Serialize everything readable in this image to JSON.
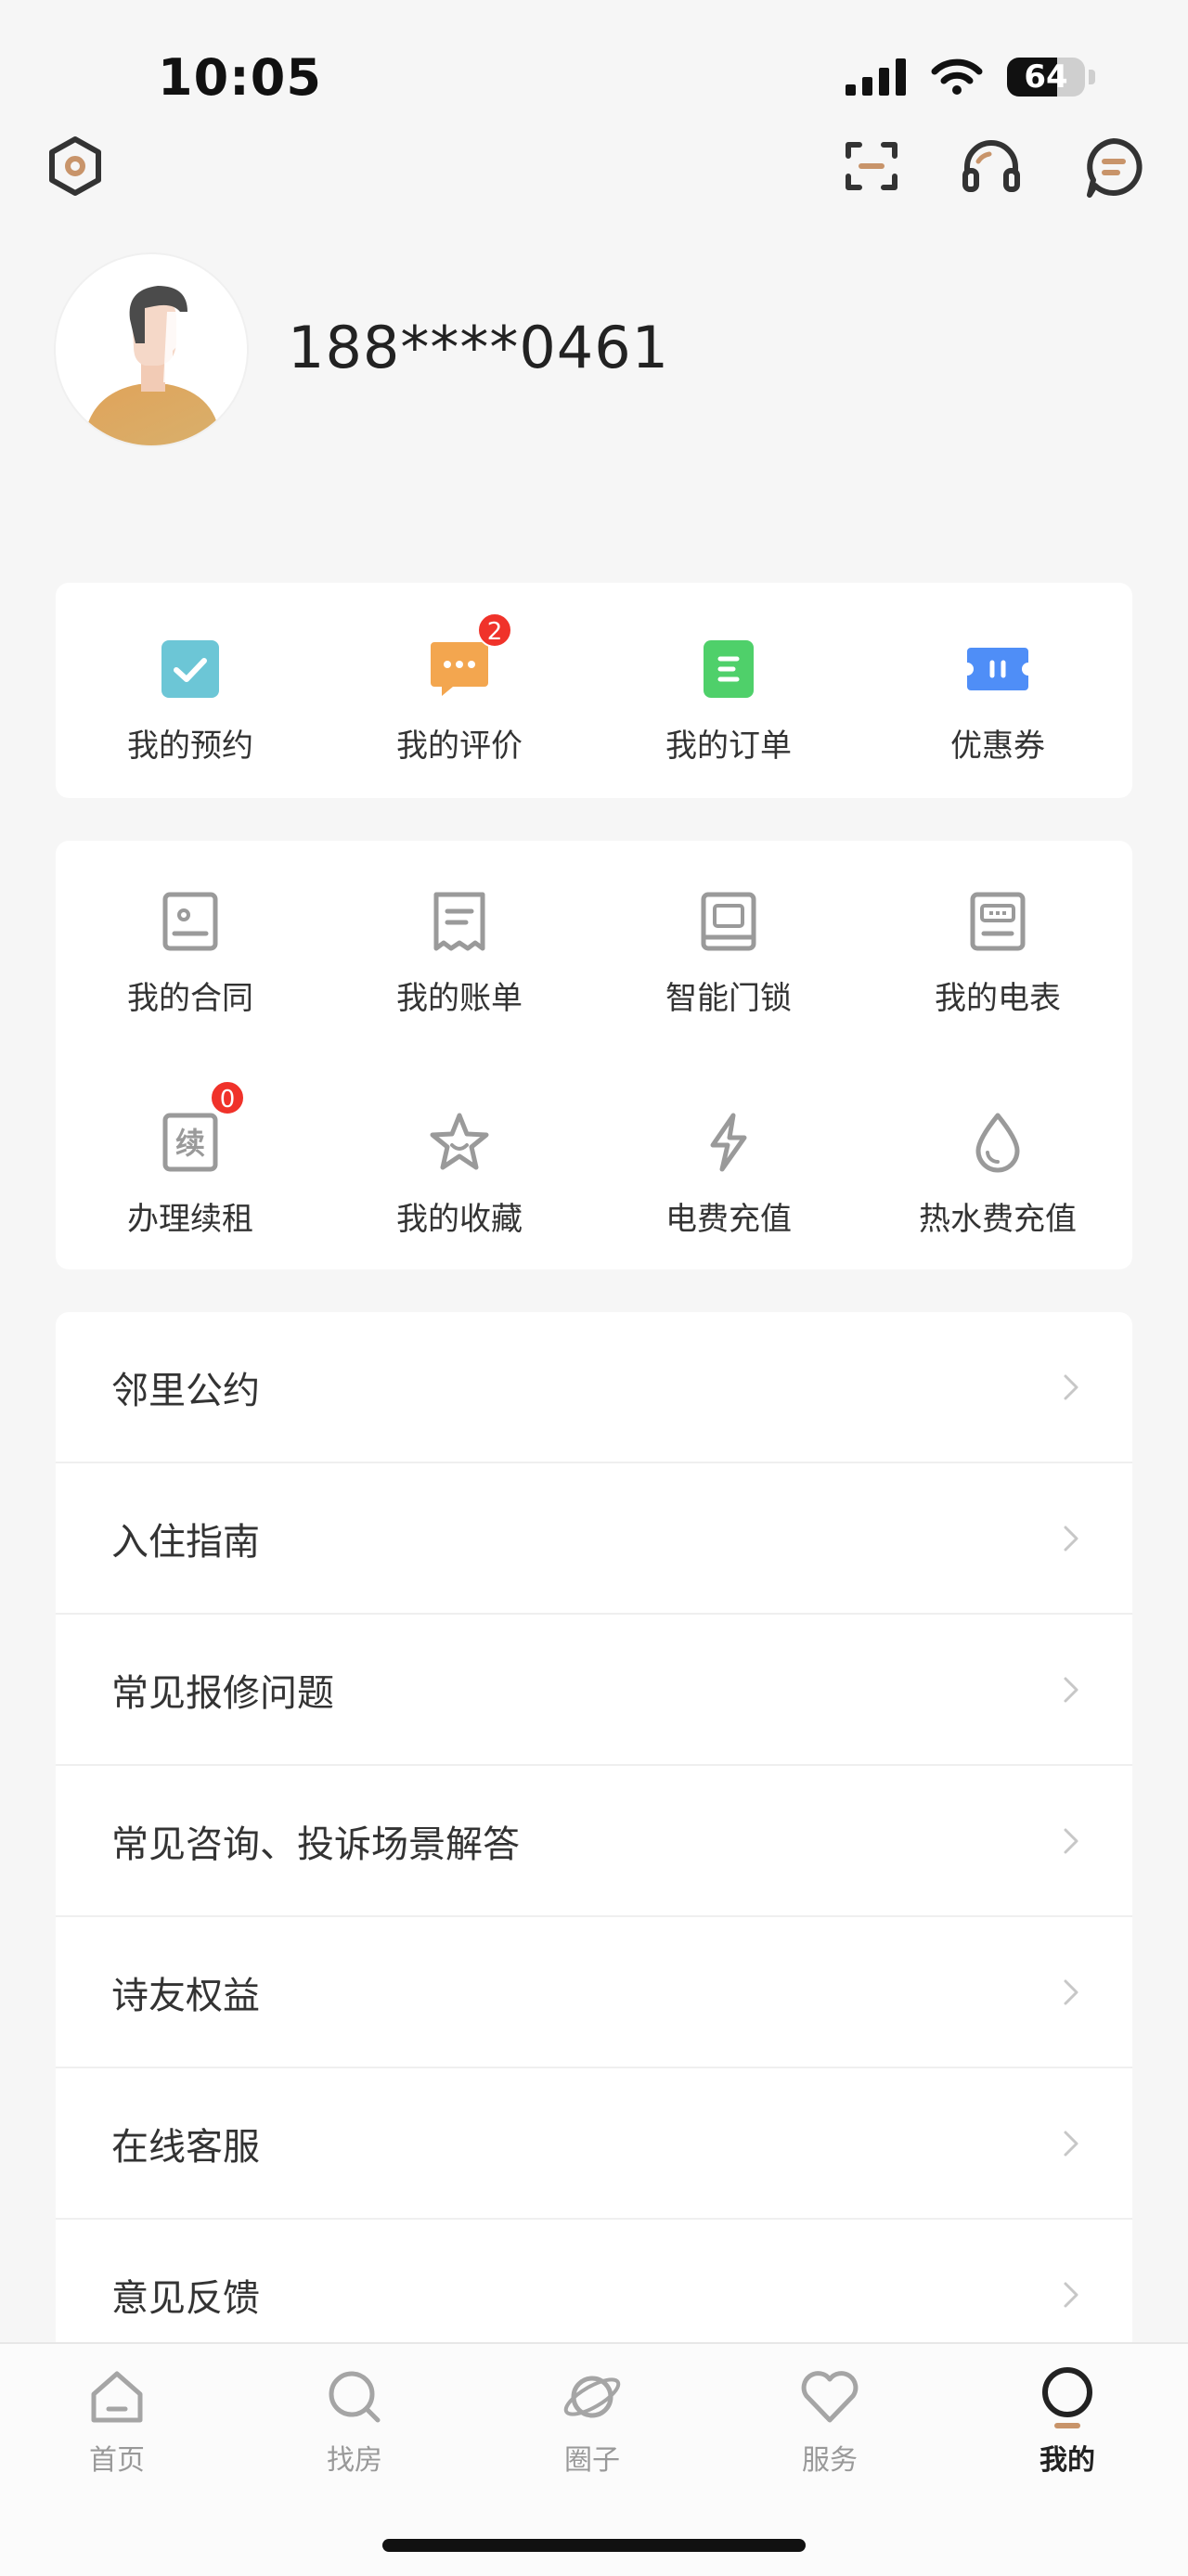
{
  "status_bar": {
    "time": "10:05",
    "battery": "64",
    "battery_level": 0.64
  },
  "top_bar": {
    "icons": [
      "settings-hex-icon",
      "scan-icon",
      "headset-icon",
      "message-icon"
    ]
  },
  "profile": {
    "phone": "188****0461"
  },
  "quick_actions": [
    {
      "label": "我的预约",
      "icon": "appointment-icon",
      "color": "#6cc6d6",
      "badge": ""
    },
    {
      "label": "我的评价",
      "icon": "review-icon",
      "color": "#f3a64f",
      "badge": "2"
    },
    {
      "label": "我的订单",
      "icon": "order-icon",
      "color": "#4fd06a",
      "badge": ""
    },
    {
      "label": "优惠券",
      "icon": "coupon-icon",
      "color": "#4f8ef7",
      "badge": ""
    }
  ],
  "services": [
    {
      "label": "我的合同",
      "icon": "contract-icon",
      "badge": ""
    },
    {
      "label": "我的账单",
      "icon": "bill-icon",
      "badge": ""
    },
    {
      "label": "智能门锁",
      "icon": "smart-lock-icon",
      "badge": ""
    },
    {
      "label": "我的电表",
      "icon": "electric-meter-icon",
      "badge": ""
    },
    {
      "label": "办理续租",
      "icon": "renew-lease-icon",
      "badge": "0",
      "glyph": "续"
    },
    {
      "label": "我的收藏",
      "icon": "favorite-star-icon",
      "badge": ""
    },
    {
      "label": "电费充值",
      "icon": "lightning-icon",
      "badge": ""
    },
    {
      "label": "热水费充值",
      "icon": "water-drop-icon",
      "badge": ""
    }
  ],
  "menu": [
    {
      "label": "邻里公约"
    },
    {
      "label": "入住指南"
    },
    {
      "label": "常见报修问题"
    },
    {
      "label": "常见咨询、投诉场景解答"
    },
    {
      "label": "诗友权益"
    },
    {
      "label": "在线客服"
    },
    {
      "label": "意见反馈"
    }
  ],
  "tabbar": [
    {
      "label": "首页",
      "icon": "home-icon",
      "active": false
    },
    {
      "label": "找房",
      "icon": "search-icon",
      "active": false
    },
    {
      "label": "圈子",
      "icon": "planet-icon",
      "active": false
    },
    {
      "label": "服务",
      "icon": "heart-icon",
      "active": false
    },
    {
      "label": "我的",
      "icon": "profile-circle-icon",
      "active": true
    }
  ],
  "colors": {
    "accent": "#c8946a",
    "badge": "#f0322a",
    "icon_gray": "#9a9a9a"
  }
}
